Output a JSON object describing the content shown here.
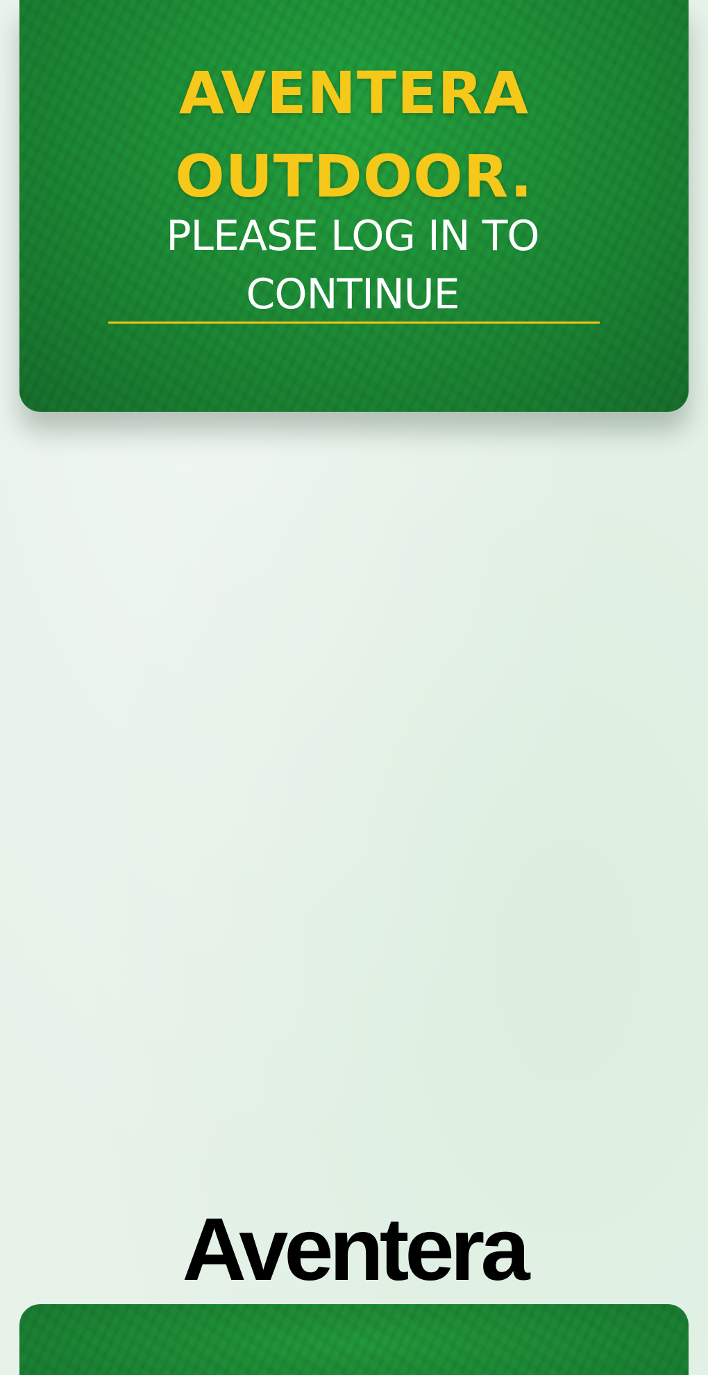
{
  "header": {
    "brand_line1": "AVENTERA",
    "brand_line2": "OUTDOOR.",
    "subtitle": "PLEASE LOG IN TO CONTINUE"
  },
  "footer": {
    "logo_text": "Aventera"
  },
  "colors": {
    "brand_green": "#1f9339",
    "accent_yellow": "#f6c819",
    "background": "#e7f2e9"
  }
}
